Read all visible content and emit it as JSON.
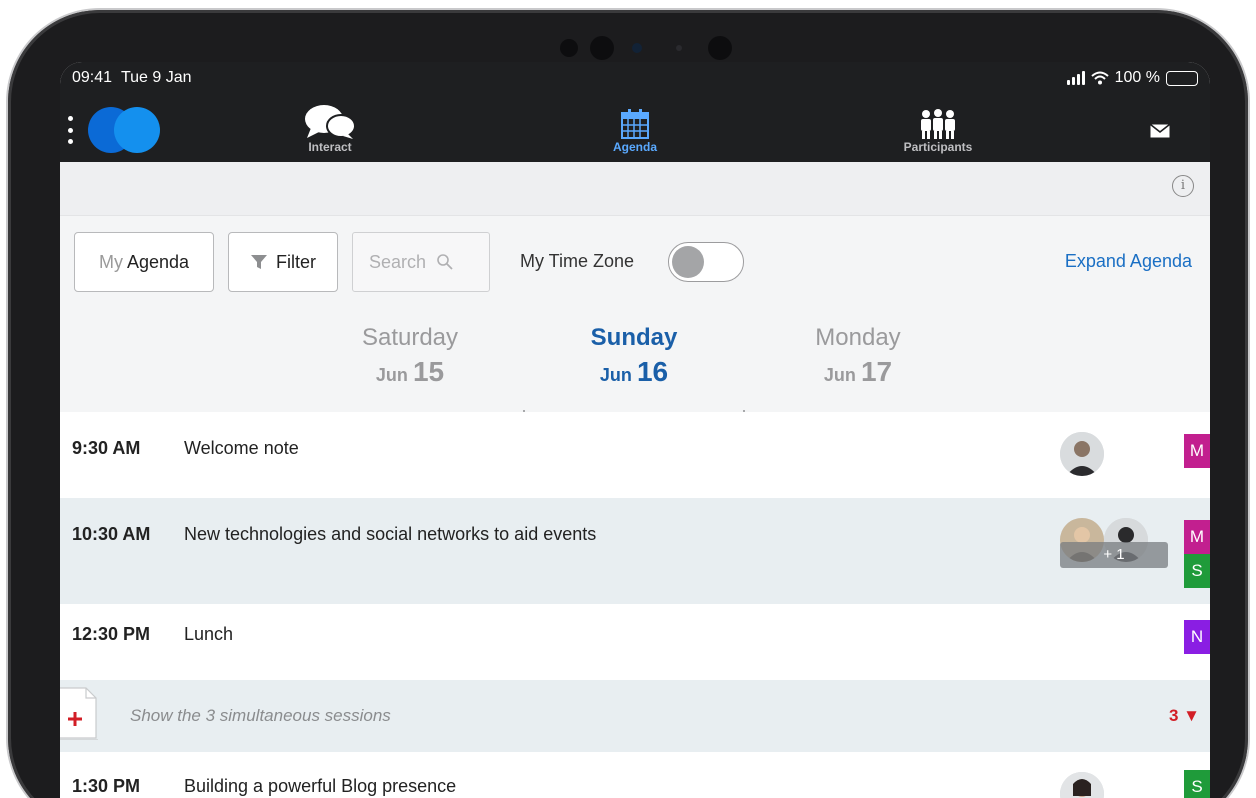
{
  "status_bar": {
    "time": "09:41",
    "date": "Tue 9 Jan",
    "battery": "100 %"
  },
  "nav": {
    "interact": "Interact",
    "agenda": "Agenda",
    "participants": "Participants",
    "active": "Agenda"
  },
  "toolbar": {
    "my_agenda_prefix": "My",
    "my_agenda_label": "Agenda",
    "filter_label": "Filter",
    "search_placeholder": "Search",
    "time_zone_label": "My Time Zone",
    "time_zone_on": false,
    "expand_label": "Expand Agenda"
  },
  "days": [
    {
      "name": "Saturday",
      "month": "Jun",
      "day": "15",
      "selected": false
    },
    {
      "name": "Sunday",
      "month": "Jun",
      "day": "16",
      "selected": true
    },
    {
      "name": "Monday",
      "month": "Jun",
      "day": "17",
      "selected": false
    }
  ],
  "sessions": [
    {
      "time": "9:30 AM",
      "title": "Welcome note",
      "tags": [
        "M"
      ]
    },
    {
      "time": "10:30 AM",
      "title": "New technologies and social networks to aid events",
      "tags": [
        "M",
        "S"
      ],
      "more_speakers": "+ 1"
    },
    {
      "time": "12:30 PM",
      "title": "Lunch",
      "tags": [
        "N"
      ]
    },
    {
      "time": "1:30 PM",
      "title": "Building a powerful Blog presence",
      "tags": [
        "S"
      ]
    }
  ],
  "simultaneous": {
    "label": "Show the 3 simultaneous sessions",
    "count": "3"
  },
  "colors": {
    "accent_blue": "#1a6fc4",
    "tag_m": "#c21f8f",
    "tag_s": "#1f9b3a",
    "tag_n": "#8a1ee3",
    "alert_red": "#d21e26"
  }
}
